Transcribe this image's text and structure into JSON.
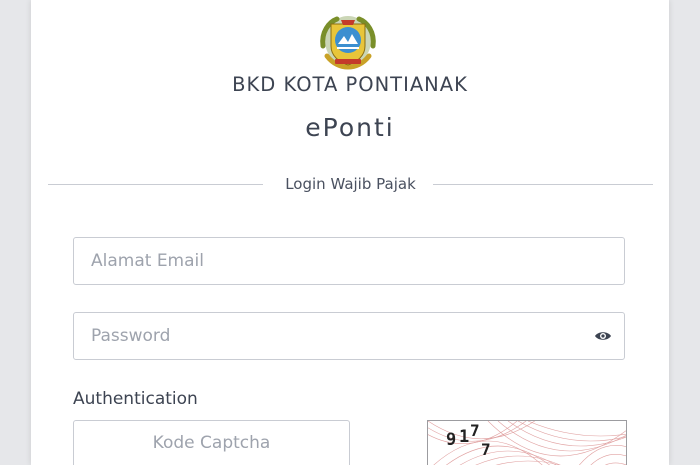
{
  "header": {
    "org_name": "BKD KOTA PONTIANAK",
    "app_name": "ePonti",
    "logo_icon": "pontianak-city-emblem"
  },
  "login": {
    "section_title": "Login Wajib Pajak",
    "email": {
      "placeholder": "Alamat Email",
      "value": ""
    },
    "password": {
      "placeholder": "Password",
      "value": "",
      "toggle_icon": "eye-icon"
    },
    "auth_label": "Authentication",
    "captcha": {
      "placeholder": "Kode Captcha",
      "value": "",
      "image_text": "917 7"
    }
  },
  "colors": {
    "text": "#3d4452",
    "placeholder": "#9ea3ad",
    "border": "#c9ccd3",
    "background": "#e6e7ea"
  }
}
